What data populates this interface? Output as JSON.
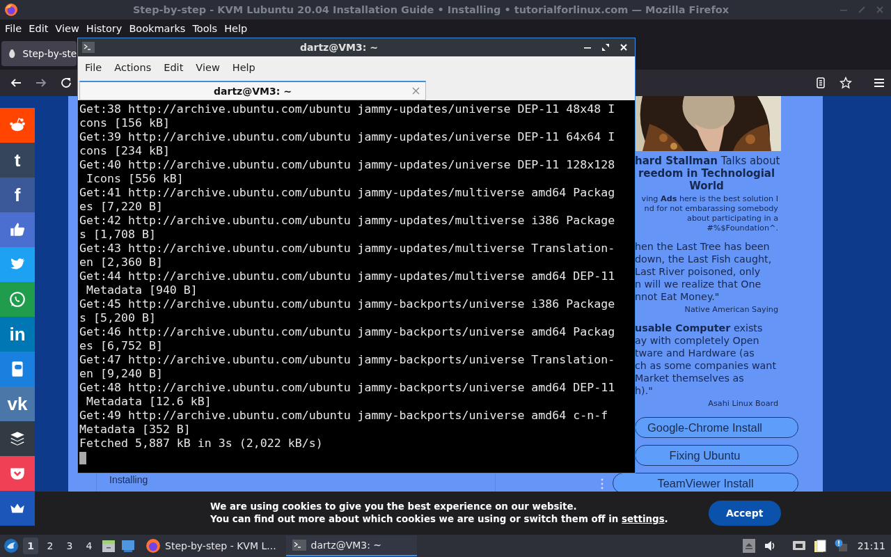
{
  "firefox": {
    "title": "Step-by-step - KVM Lubuntu 20.04 Installation Guide • Installing • tutorialforlinux.com — Mozilla Firefox",
    "menu": [
      "File",
      "Edit",
      "View",
      "History",
      "Bookmarks",
      "Tools",
      "Help"
    ],
    "tab": {
      "label": "Step-by-ste"
    }
  },
  "page": {
    "share_buttons": [
      {
        "kind": "alien",
        "color": "#ff4500"
      },
      {
        "kind": "glyph",
        "glyph": "t",
        "color": "#35465c"
      },
      {
        "kind": "glyph",
        "glyph": "f",
        "color": "#3b5998"
      },
      {
        "kind": "thumb",
        "color": "#4a6fd0"
      },
      {
        "kind": "bird",
        "color": "#1da1f2"
      },
      {
        "kind": "phone",
        "color": "#1f9d4c"
      },
      {
        "kind": "glyph",
        "glyph": "in",
        "color": "#0077b5"
      },
      {
        "kind": "chat",
        "color": "#1a80e0"
      },
      {
        "kind": "glyph",
        "glyph": "vk",
        "color": "#4a76a8"
      },
      {
        "kind": "layers",
        "color": "#323b43"
      },
      {
        "kind": "pocket",
        "color": "#ef4056"
      },
      {
        "kind": "crown",
        "color": "#1b56b8"
      }
    ],
    "nav_item": "Installing",
    "sidebar": {
      "blocks": [
        {
          "kind": "headline",
          "lines": [
            "**hard Stallman** Talks about",
            "**reedom in Technologial**",
            "**World**"
          ]
        },
        {
          "kind": "note",
          "lines": [
            "ving **Ads** here is the best solution I",
            "nd for not embarassing somebody",
            "about participating in a",
            "#%$Foundation^."
          ]
        },
        {
          "kind": "quote",
          "lines": [
            "hen the Last Tree has been",
            "down, the Last Fish caught,",
            "Last River poisoned, only",
            "n will we realize that One",
            "nnot Eat Money.\""
          ]
        },
        {
          "kind": "source",
          "lines": [
            "Native American Saying"
          ]
        },
        {
          "kind": "quote",
          "lines": [
            "**usable Computer** exists",
            "ay with completely Open",
            "tware and Hardware (as",
            "ch as some companies want",
            "Market themselves as",
            "h).\""
          ]
        },
        {
          "kind": "source",
          "lines": [
            "Asahi Linux Board"
          ]
        }
      ],
      "buttons": [
        "Google-Chrome Install",
        "Fixing Ubuntu",
        "TeamViewer Install"
      ]
    },
    "cookie_bar": {
      "line1": "We are using cookies to give you the best experience on our website.",
      "line2": "You can find out more about which cookies we are using or switch them off in",
      "link": "settings",
      "tail": ".",
      "accept": "Accept"
    }
  },
  "terminal": {
    "title": "dartz@VM3: ~",
    "menu": [
      "File",
      "Actions",
      "Edit",
      "View",
      "Help"
    ],
    "tab": {
      "label": "dartz@VM3: ~"
    },
    "lines": [
      "Get:38 http://archive.ubuntu.com/ubuntu jammy-updates/universe DEP-11 48x48 I",
      "cons [156 kB]",
      "Get:39 http://archive.ubuntu.com/ubuntu jammy-updates/universe DEP-11 64x64 I",
      "cons [234 kB]",
      "Get:40 http://archive.ubuntu.com/ubuntu jammy-updates/universe DEP-11 128x128",
      " Icons [556 kB]",
      "Get:41 http://archive.ubuntu.com/ubuntu jammy-updates/multiverse amd64 Packag",
      "es [7,220 B]",
      "Get:42 http://archive.ubuntu.com/ubuntu jammy-updates/multiverse i386 Package",
      "s [1,708 B]",
      "Get:43 http://archive.ubuntu.com/ubuntu jammy-updates/multiverse Translation-",
      "en [2,360 B]",
      "Get:44 http://archive.ubuntu.com/ubuntu jammy-updates/multiverse amd64 DEP-11",
      " Metadata [940 B]",
      "Get:45 http://archive.ubuntu.com/ubuntu jammy-backports/universe i386 Package",
      "s [5,200 B]",
      "Get:46 http://archive.ubuntu.com/ubuntu jammy-backports/universe amd64 Packag",
      "es [6,752 B]",
      "Get:47 http://archive.ubuntu.com/ubuntu jammy-backports/universe Translation-",
      "en [9,240 B]",
      "Get:48 http://archive.ubuntu.com/ubuntu jammy-backports/universe amd64 DEP-11",
      " Metadata [12.6 kB]",
      "Get:49 http://archive.ubuntu.com/ubuntu jammy-backports/universe amd64 c-n-f",
      "Metadata [352 B]",
      "Fetched 5,887 kB in 3s (2,022 kB/s)"
    ]
  },
  "taskbar": {
    "workspaces": [
      {
        "label": "1",
        "selected": true
      },
      {
        "label": "2",
        "selected": false
      },
      {
        "label": "3",
        "selected": false
      },
      {
        "label": "4",
        "selected": false
      }
    ],
    "tasks": [
      {
        "kind": "browser",
        "label": "Step-by-step - KVM L...",
        "selected": false
      },
      {
        "kind": "terminal",
        "label": "dartz@VM3: ~",
        "selected": true
      }
    ],
    "clock": "21:11"
  }
}
